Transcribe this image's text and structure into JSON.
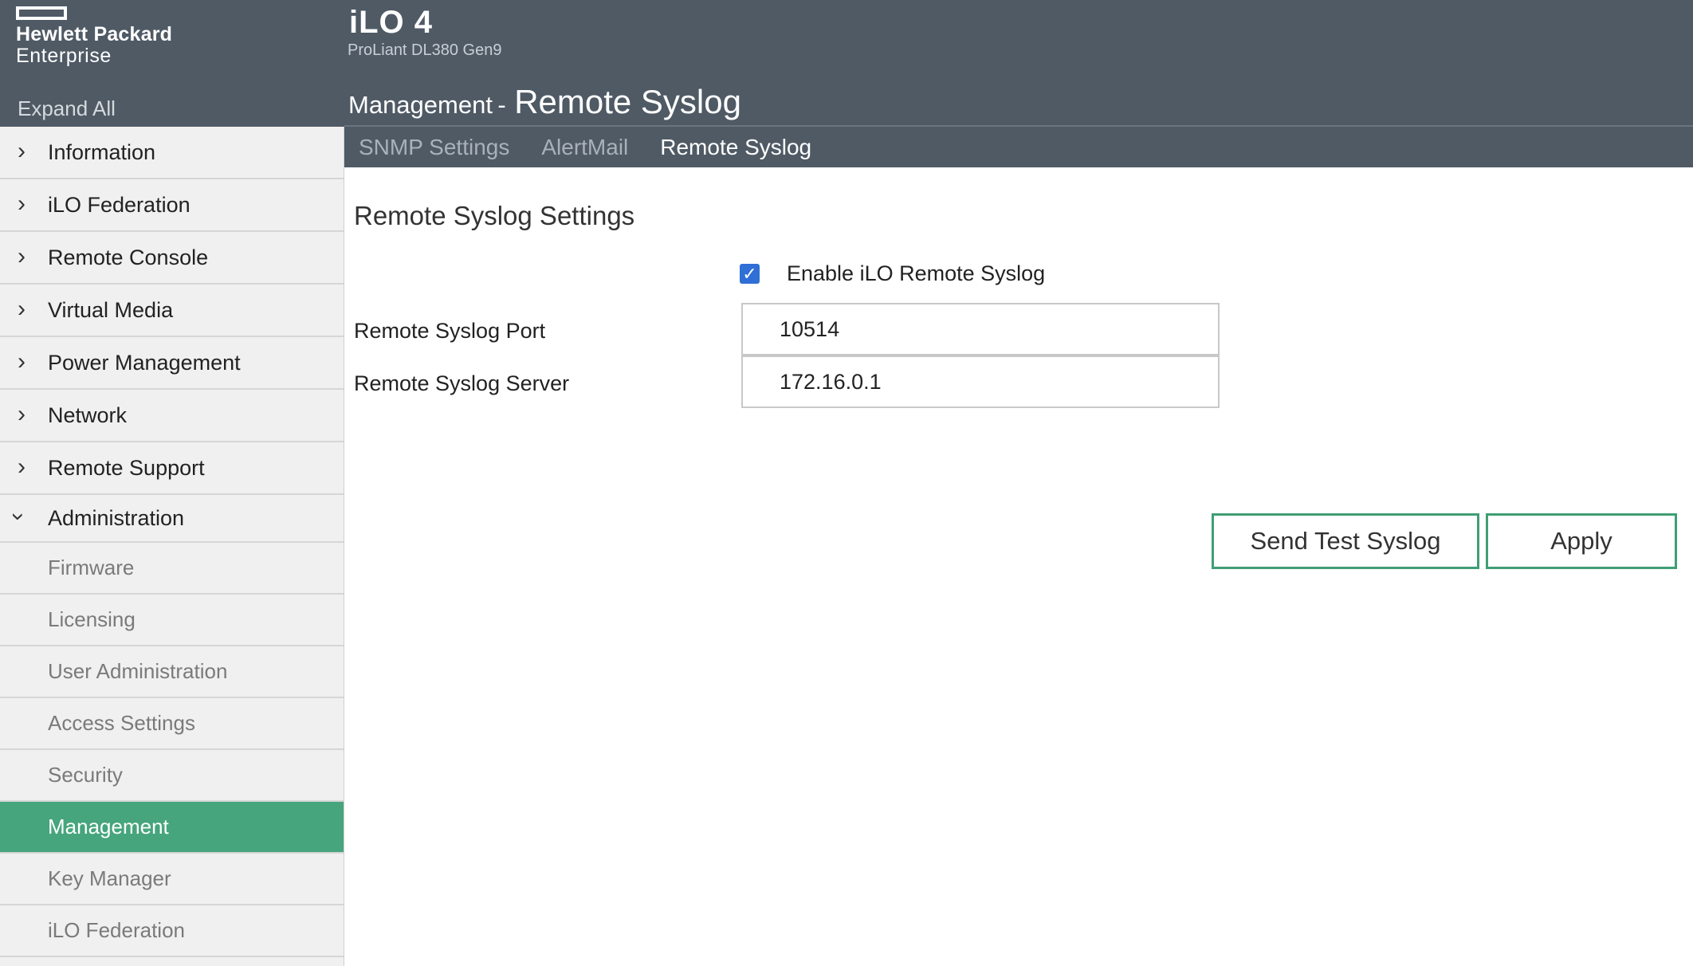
{
  "brand": {
    "line1": "Hewlett Packard",
    "line2": "Enterprise"
  },
  "header": {
    "product": "iLO 4",
    "server_model": "ProLiant DL380 Gen9",
    "breadcrumb_parent": "Management",
    "breadcrumb_sep": "-",
    "page_title": "Remote Syslog"
  },
  "sidebar": {
    "expand_all": "Expand All",
    "items": [
      {
        "label": "Information"
      },
      {
        "label": "iLO Federation"
      },
      {
        "label": "Remote Console"
      },
      {
        "label": "Virtual Media"
      },
      {
        "label": "Power Management"
      },
      {
        "label": "Network"
      },
      {
        "label": "Remote Support"
      }
    ],
    "admin_label": "Administration",
    "sub_items": [
      {
        "label": "Firmware"
      },
      {
        "label": "Licensing"
      },
      {
        "label": "User Administration"
      },
      {
        "label": "Access Settings"
      },
      {
        "label": "Security"
      },
      {
        "label": "Management"
      },
      {
        "label": "Key Manager"
      },
      {
        "label": "iLO Federation"
      }
    ],
    "active_sub_item": "Management"
  },
  "tabs": [
    {
      "label": "SNMP Settings"
    },
    {
      "label": "AlertMail"
    },
    {
      "label": "Remote Syslog"
    }
  ],
  "active_tab": "Remote Syslog",
  "content": {
    "section_title": "Remote Syslog Settings",
    "enable_label": "Enable iLO Remote Syslog",
    "enable_checked": true,
    "port_label": "Remote Syslog Port",
    "port_value": "10514",
    "server_label": "Remote Syslog Server",
    "server_value": "172.16.0.1",
    "send_test_label": "Send Test Syslog",
    "apply_label": "Apply"
  },
  "colors": {
    "header_bg": "#4f5a65",
    "accent_green": "#46a57c",
    "checkbox_blue": "#2f6fd6"
  },
  "icons": {
    "collapsed": "chevron-right-icon",
    "expanded": "chevron-down-icon",
    "checkbox": "check-icon"
  }
}
